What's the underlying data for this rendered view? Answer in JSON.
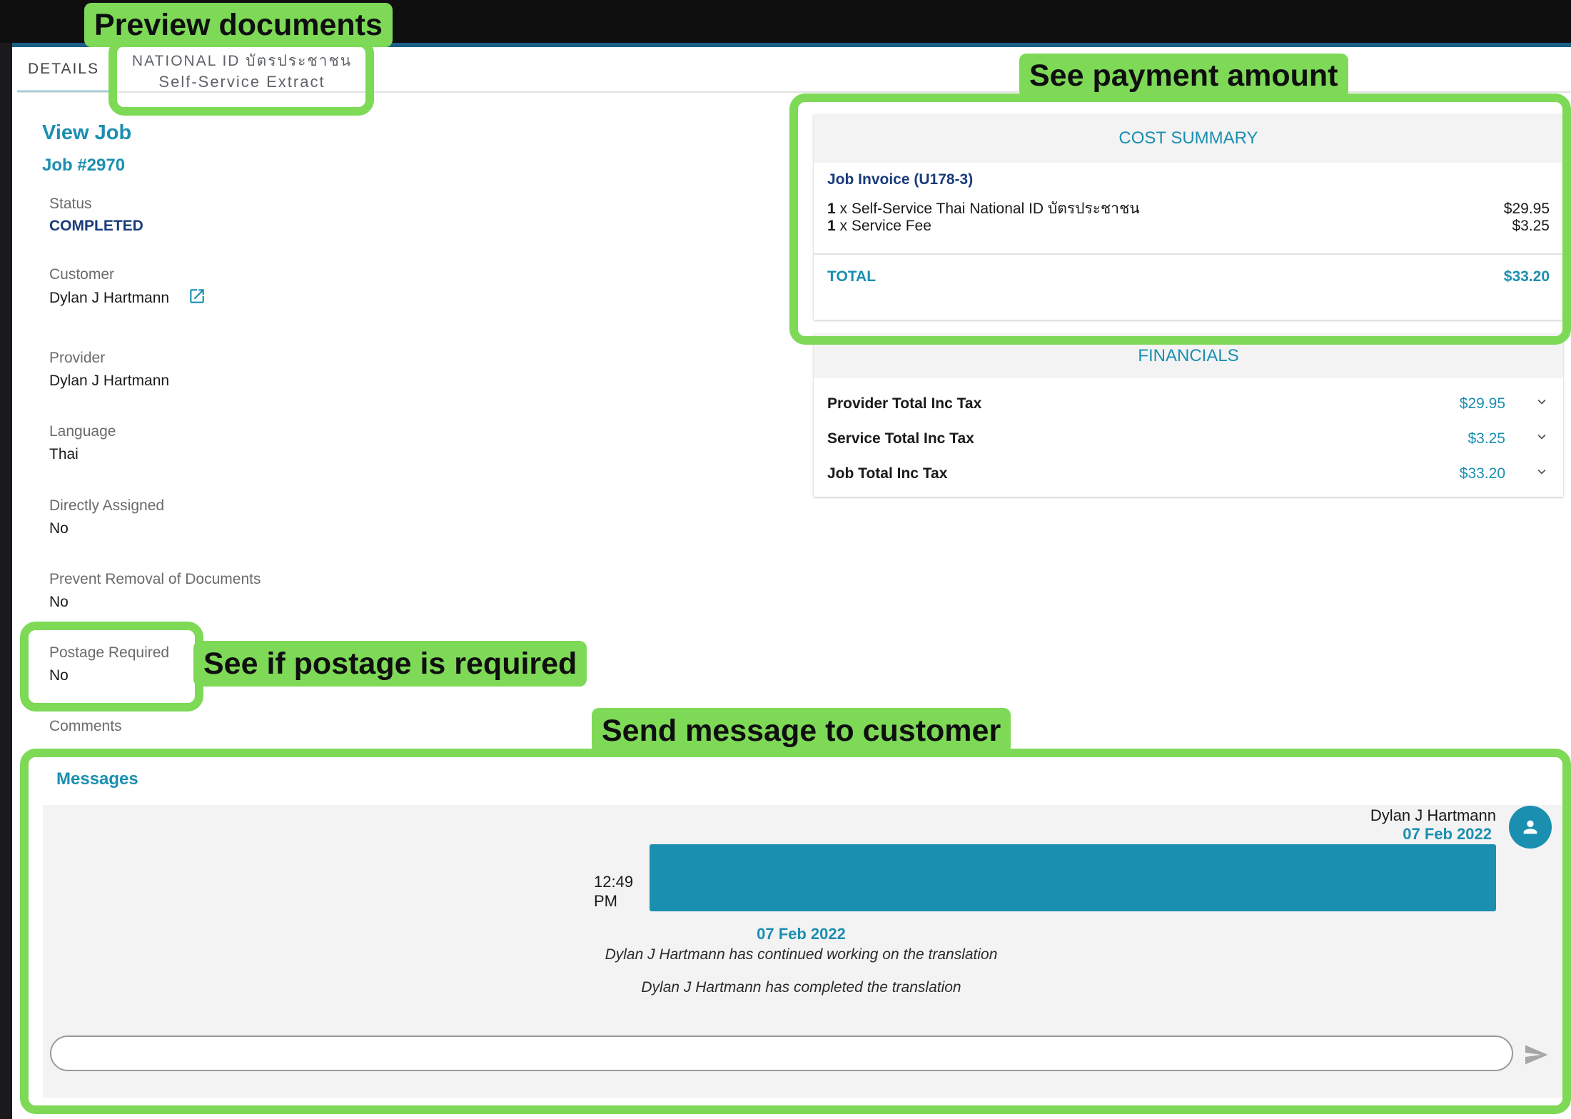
{
  "callouts": {
    "preview": "Preview documents",
    "payment": "See payment amount",
    "postage": "See if postage is required",
    "message": "Send message to customer"
  },
  "tabs": [
    {
      "label": "DETAILS"
    },
    {
      "label": "NATIONAL ID บัตรประชาชน",
      "sub": "Self-Service Extract"
    }
  ],
  "job": {
    "view_title": "View Job",
    "job_number": "Job #2970",
    "fields": [
      {
        "label": "Status",
        "value": "COMPLETED"
      },
      {
        "label": "Customer",
        "value": "Dylan J Hartmann"
      },
      {
        "label": "Provider",
        "value": "Dylan J Hartmann"
      },
      {
        "label": "Language",
        "value": "Thai"
      },
      {
        "label": "Directly Assigned",
        "value": "No"
      },
      {
        "label": "Prevent Removal of Documents",
        "value": "No"
      },
      {
        "label": "Postage Required",
        "value": "No"
      },
      {
        "label": "Comments",
        "value": ""
      }
    ]
  },
  "cost_summary": {
    "title": "COST SUMMARY",
    "invoice": "Job Invoice (U178-3)",
    "lines": [
      {
        "qty": "1",
        "desc": " x Self-Service Thai National ID บัตรประชาชน",
        "amount": "$29.95"
      },
      {
        "qty": "1",
        "desc": " x Service Fee",
        "amount": "$3.25"
      }
    ],
    "total_label": "TOTAL",
    "total_value": "$33.20"
  },
  "financials": {
    "title": "FINANCIALS",
    "rows": [
      {
        "label": "Provider Total Inc Tax",
        "value": "$29.95"
      },
      {
        "label": "Service Total Inc Tax",
        "value": "$3.25"
      },
      {
        "label": "Job Total Inc Tax",
        "value": "$33.20"
      }
    ]
  },
  "messages": {
    "title": "Messages",
    "sender": "Dylan J Hartmann",
    "sender_date": "07 Feb 2022",
    "time": "12:49 PM",
    "event_date": "07 Feb 2022",
    "events": [
      "Dylan J Hartmann has continued working on the translation",
      "Dylan J Hartmann has completed the translation"
    ],
    "input_placeholder": ""
  },
  "colors": {
    "accent": "#1b8fb0",
    "highlight": "#7ed957",
    "status": "#1a3c7a"
  }
}
